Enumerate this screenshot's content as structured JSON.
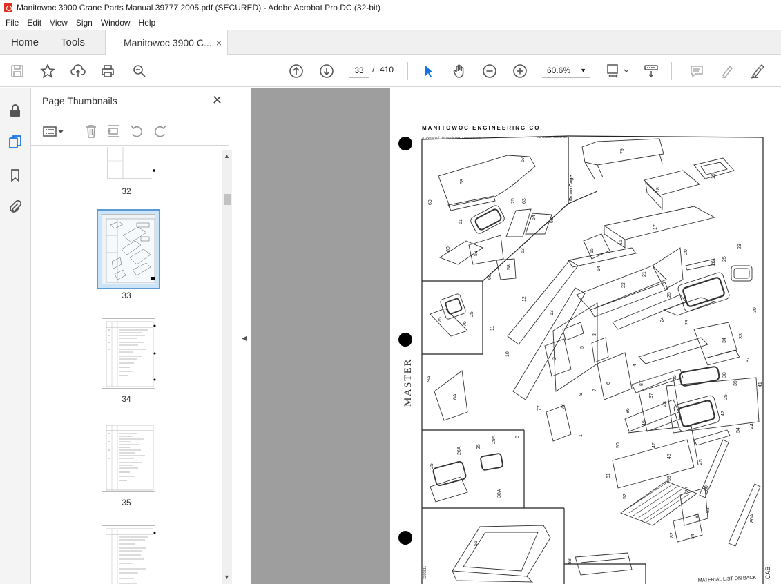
{
  "window": {
    "title": "Manitowoc 3900 Crane Parts Manual 39777 2005.pdf (SECURED) - Adobe Acrobat Pro DC (32-bit)"
  },
  "menu": {
    "items": [
      "File",
      "Edit",
      "View",
      "Sign",
      "Window",
      "Help"
    ]
  },
  "tabs": {
    "home": "Home",
    "tools": "Tools",
    "document": "Manitowoc 3900 C...",
    "close_glyph": "×"
  },
  "toolbar": {
    "current_page": "33",
    "page_separator": "/",
    "total_pages": "410",
    "zoom": "60.6%"
  },
  "panel": {
    "title": "Page Thumbnails",
    "close_glyph": "✕",
    "thumbnails": [
      {
        "label": "32"
      },
      {
        "label": "33",
        "selected": true
      },
      {
        "label": "34"
      },
      {
        "label": "35"
      },
      {
        "label": ""
      }
    ]
  },
  "document_page": {
    "header": "MANITOWOC ENGINEERING CO.",
    "subheader_left": "A Division of The Manitowoc Company, Inc.",
    "subheader_right": "Manitowoc, Wisconsin",
    "section_label": "Drum Cage",
    "side_label": "MASTER",
    "footer_note": "MATERIAL LIST ON BACK",
    "corner_label": "CAB",
    "drawing_number": "3399811"
  },
  "colors": {
    "accent": "#1473e6",
    "viewer_bg": "#9e9e9e",
    "thumb_selected_bg": "#cce4f7"
  }
}
